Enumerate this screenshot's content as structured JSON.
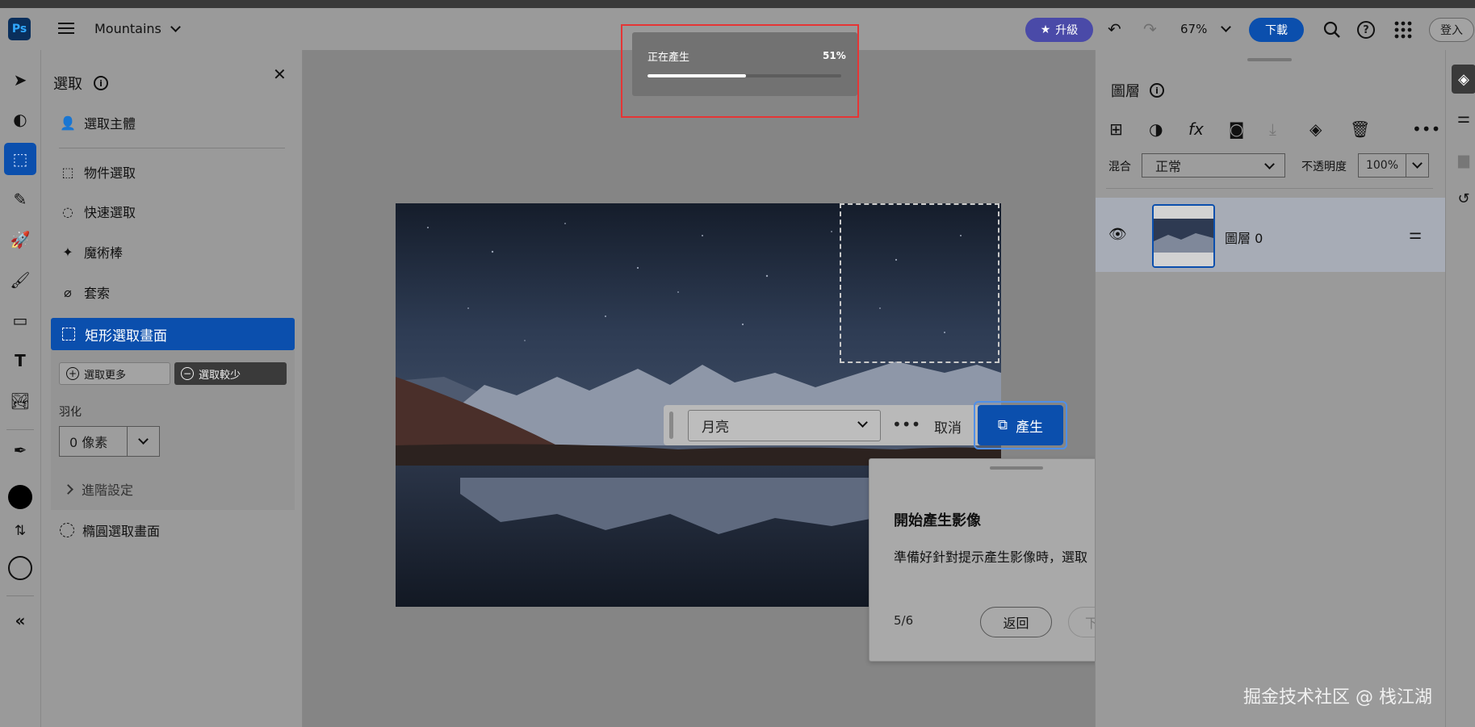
{
  "app": {
    "logo_text": "Ps",
    "document_title": "Mountains"
  },
  "header": {
    "upgrade_label": "升級",
    "zoom": "67%",
    "download_label": "下載",
    "signin_label": "登入"
  },
  "selection_panel": {
    "title": "選取",
    "items": [
      {
        "label": "選取主體",
        "icon": "select-subject-icon"
      },
      {
        "label": "物件選取",
        "icon": "object-select-icon"
      },
      {
        "label": "快速選取",
        "icon": "quick-select-icon"
      },
      {
        "label": "魔術棒",
        "icon": "magic-wand-icon"
      },
      {
        "label": "套索",
        "icon": "lasso-icon"
      }
    ],
    "active_item": "矩形選取畫面",
    "add_label": "選取更多",
    "subtract_label": "選取較少",
    "feather_label": "羽化",
    "feather_value": "0 像素",
    "advanced_label": "進階設定",
    "ellipse_label": "橢圓選取畫面"
  },
  "progress": {
    "label": "正在產生",
    "percent_text": "51%",
    "fraction": 0.51
  },
  "taskbar": {
    "prompt_value": "月亮",
    "more_label": "•••",
    "cancel_label": "取消",
    "generate_label": "產生"
  },
  "tutorial": {
    "title": "開始產生影像",
    "more_label": "•••",
    "body": "準備好針對提示產生影像時，選取「產生」。",
    "step": "5/6",
    "back_label": "返回",
    "next_label": "下一個"
  },
  "layers_panel": {
    "title": "圖層",
    "blend_label": "混合",
    "blend_value": "正常",
    "opacity_label": "不透明度",
    "opacity_value": "100%",
    "layers": [
      {
        "name": "圖層 0",
        "visible": true
      }
    ]
  },
  "watermark": "掘金技术社区 @ 栈江湖",
  "colors": {
    "accent": "#0b4fad",
    "highlight_box": "#e53535",
    "upgrade": "#4a4aa8"
  }
}
